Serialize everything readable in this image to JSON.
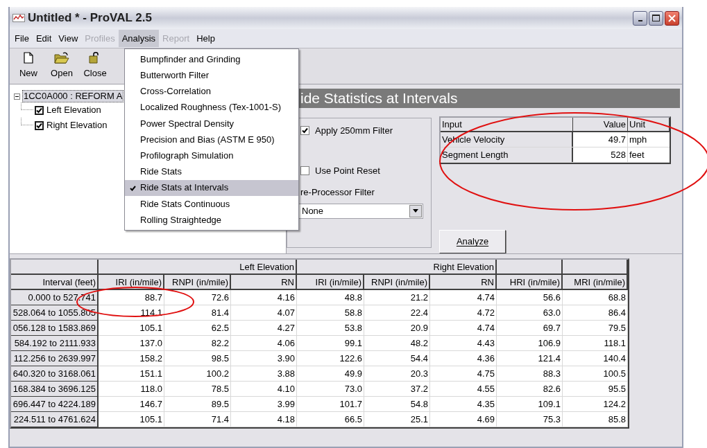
{
  "window": {
    "title": "Untitled * - ProVAL 2.5"
  },
  "menu_bar": [
    {
      "label": "File",
      "selected": false,
      "disabled": false
    },
    {
      "label": "Edit",
      "selected": false,
      "disabled": false
    },
    {
      "label": "View",
      "selected": false,
      "disabled": false
    },
    {
      "label": "Profiles",
      "selected": false,
      "disabled": true
    },
    {
      "label": "Analysis",
      "selected": true,
      "disabled": false
    },
    {
      "label": "Report",
      "selected": false,
      "disabled": true
    },
    {
      "label": "Help",
      "selected": false,
      "disabled": false
    }
  ],
  "toolbar": [
    {
      "label": "New",
      "kind": "new"
    },
    {
      "label": "Open",
      "kind": "open"
    },
    {
      "label": "Close",
      "kind": "close"
    }
  ],
  "tree": {
    "label": "1CC0A000 : REFORM A",
    "expanded": true,
    "children": [
      {
        "label": "Left Elevation",
        "checked": true
      },
      {
        "label": "Right Elevation",
        "checked": true
      }
    ]
  },
  "analysis_menu": [
    {
      "label": "Bumpfinder and Grinding",
      "selected": false
    },
    {
      "label": "Butterworth Filter",
      "selected": false
    },
    {
      "label": "Cross-Correlation",
      "selected": false
    },
    {
      "label": "Localized Roughness (Tex-1001-S)",
      "selected": false
    },
    {
      "label": "Power Spectral Density",
      "selected": false
    },
    {
      "label": "Precision and Bias (ASTM E 950)",
      "selected": false
    },
    {
      "label": "Profilograph Simulation",
      "selected": false
    },
    {
      "label": "Ride Stats",
      "selected": false
    },
    {
      "label": "Ride Stats at Intervals",
      "selected": true
    },
    {
      "label": "Ride Stats Continuous",
      "selected": false
    },
    {
      "label": "Rolling Straightedge",
      "selected": false
    }
  ],
  "panel": {
    "title": "ide Statistics at Intervals",
    "options": [
      {
        "label": "Apply 250mm Filter",
        "checked": true
      },
      {
        "label": "Use Point Reset",
        "checked": false
      }
    ],
    "filter_label": "re-Processor Filter",
    "filter_value": "None",
    "inputs": {
      "columns": [
        "Input",
        "Value",
        "Unit"
      ],
      "rows": [
        [
          "Vehicle Velocity",
          "49.7",
          "mph"
        ],
        [
          "Segment Length",
          "528",
          "feet"
        ]
      ]
    },
    "analyze_button": "Analyze"
  },
  "results": {
    "first_column": "Interval (feet)",
    "column_groups": [
      {
        "label": "Left Elevation",
        "columns": [
          "IRI (in/mile)",
          "RNPI (in/mile)",
          "RN"
        ]
      },
      {
        "label": "Right Elevation",
        "columns": [
          "IRI (in/mile)",
          "RNPI (in/mile)",
          "RN"
        ]
      },
      {
        "columns": [
          "HRI (in/mile)"
        ]
      },
      {
        "columns": [
          "MRI (in/mile)"
        ]
      }
    ],
    "rows": [
      [
        "0.000 to 527.741",
        "88.7",
        "72.6",
        "4.16",
        "48.8",
        "21.2",
        "4.74",
        "56.6",
        "68.8"
      ],
      [
        "528.064 to 1055.805",
        "114.1",
        "81.4",
        "4.07",
        "58.8",
        "22.4",
        "4.72",
        "63.0",
        "86.4"
      ],
      [
        "056.128 to 1583.869",
        "105.1",
        "62.5",
        "4.27",
        "53.8",
        "20.9",
        "4.74",
        "69.7",
        "79.5"
      ],
      [
        "584.192 to 2111.933",
        "137.0",
        "82.2",
        "4.06",
        "99.1",
        "48.2",
        "4.43",
        "106.9",
        "118.1"
      ],
      [
        "112.256 to 2639.997",
        "158.2",
        "98.5",
        "3.90",
        "122.6",
        "54.4",
        "4.36",
        "121.4",
        "140.4"
      ],
      [
        "640.320 to 3168.061",
        "151.1",
        "100.2",
        "3.88",
        "49.9",
        "20.3",
        "4.75",
        "88.3",
        "100.5"
      ],
      [
        "168.384 to 3696.125",
        "118.0",
        "78.5",
        "4.10",
        "73.0",
        "37.2",
        "4.55",
        "82.6",
        "95.5"
      ],
      [
        "696.447 to 4224.189",
        "146.7",
        "89.5",
        "3.99",
        "101.7",
        "54.8",
        "4.35",
        "109.1",
        "124.2"
      ],
      [
        "224.511 to 4761.624",
        "105.1",
        "71.4",
        "4.18",
        "66.5",
        "25.1",
        "4.69",
        "75.3",
        "85.8"
      ]
    ]
  }
}
